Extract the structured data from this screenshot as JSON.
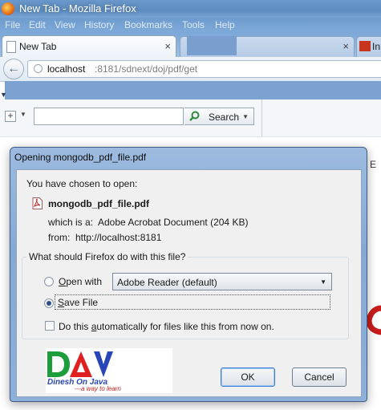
{
  "browser": {
    "window_title": "New Tab - Mozilla Firefox",
    "menu": [
      "File",
      "Edit",
      "View",
      "History",
      "Bookmarks",
      "Tools",
      "Help"
    ],
    "tabs": [
      {
        "label": "New Tab",
        "active": true
      },
      {
        "label": "",
        "active": false
      },
      {
        "label": "In",
        "active": false
      }
    ],
    "url_host": "localhost",
    "url_path": ":8181/sdnext/doj/pdf/get",
    "search_button": "Search",
    "background_partial_text": "E"
  },
  "dialog": {
    "title": "Opening mongodb_pdf_file.pdf",
    "chosen_text": "You have chosen to open:",
    "filename": "mongodb_pdf_file.pdf",
    "which_label": "which is a:",
    "which_value": "Adobe Acrobat Document (204 KB)",
    "from_label": "from:",
    "from_value": "http://localhost:8181",
    "question": "What should Firefox do with this file?",
    "open_with_label": "Open with",
    "open_with_app": "Adobe Reader  (default)",
    "save_file_label": "Save File",
    "selected_option": "save",
    "auto_label": "Do this automatically for files like this from now on.",
    "auto_checked": false,
    "ok": "OK",
    "cancel": "Cancel"
  },
  "logo": {
    "mark": "DAV",
    "name": "Dinesh On Java",
    "tagline": "---a way to learn"
  },
  "colors": {
    "chrome_blue": "#7ca2d2",
    "dialog_frame": "#8dafd8",
    "ok_focus": "#3b7dd6"
  }
}
